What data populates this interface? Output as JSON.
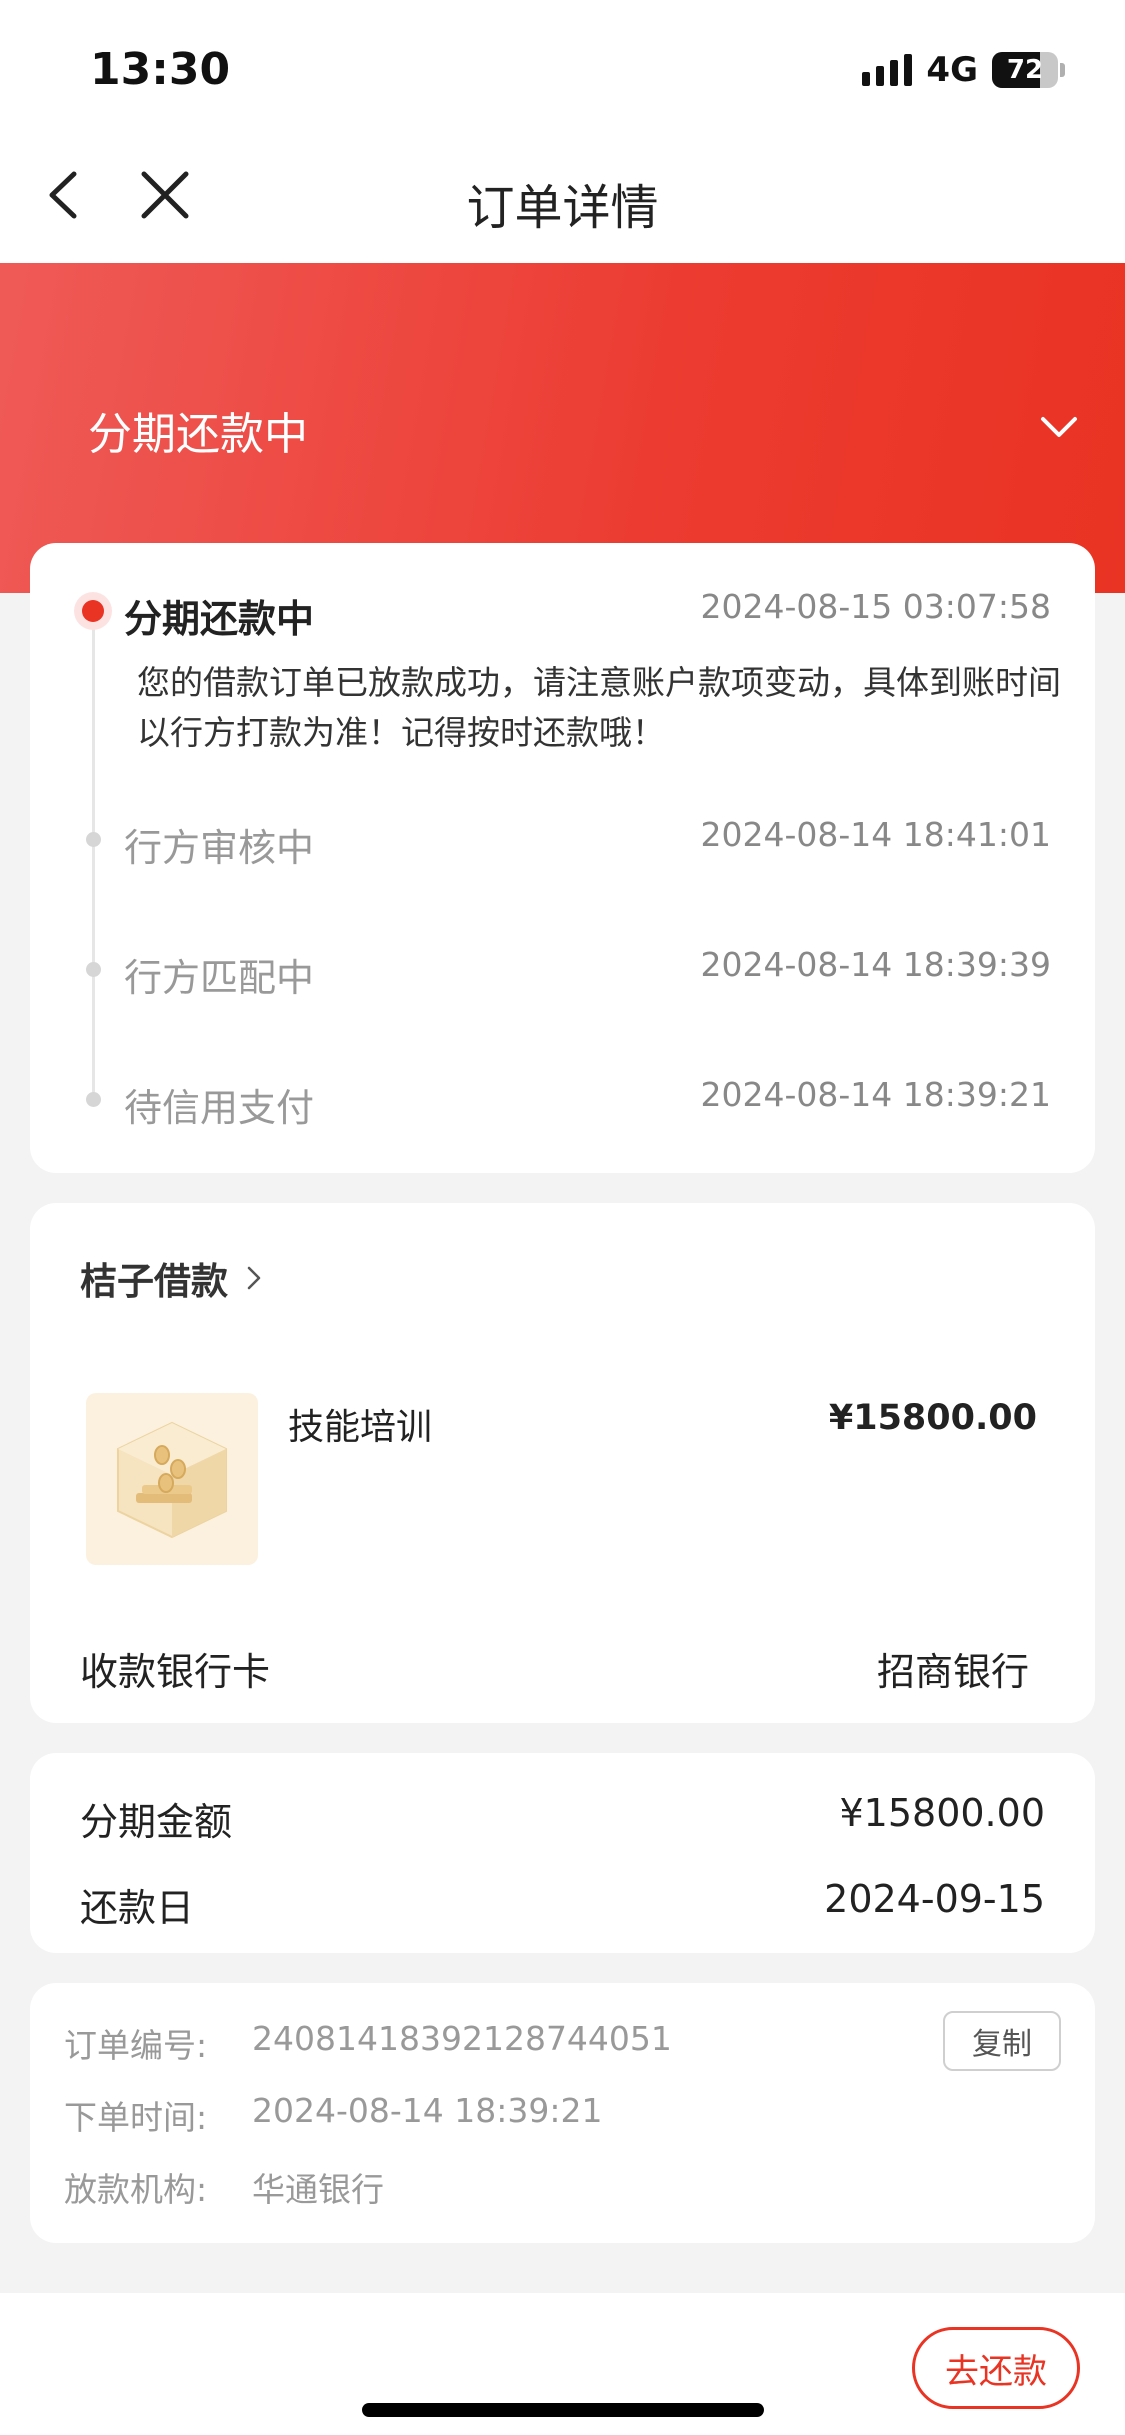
{
  "status_bar": {
    "time": "13:30",
    "network": "4G",
    "battery": "72",
    "battery_level": 0.72
  },
  "nav": {
    "title": "订单详情"
  },
  "banner": {
    "status": "分期还款中"
  },
  "timeline": [
    {
      "title": "分期还款中",
      "time": "2024-08-15 03:07:58",
      "description": "您的借款订单已放款成功，请注意账户款项变动，具体到账时间以行方打款为准！记得按时还款哦！"
    },
    {
      "title": "行方审核中",
      "time": "2024-08-14 18:41:01"
    },
    {
      "title": "行方匹配中",
      "time": "2024-08-14 18:39:39"
    },
    {
      "title": "待信用支付",
      "time": "2024-08-14 18:39:21"
    }
  ],
  "product": {
    "merchant": "桔子借款",
    "name": "技能培训",
    "price": "¥15800.00",
    "bank_label": "收款银行卡",
    "bank_value": "招商银行"
  },
  "installment": {
    "amount_label": "分期金额",
    "amount_value": "¥15800.00",
    "due_label": "还款日",
    "due_value": "2024-09-15"
  },
  "order_info": {
    "number_label": "订单编号:",
    "number_value": "24081418392128744051",
    "copy_label": "复制",
    "time_label": "下单时间:",
    "time_value": "2024-08-14 18:39:21",
    "lender_label": "放款机构:",
    "lender_value": "华通银行"
  },
  "actions": {
    "repay_label": "去还款"
  },
  "colors": {
    "accent": "#e93323",
    "banner_start": "#ef5a57",
    "background": "#f3f3f3"
  }
}
